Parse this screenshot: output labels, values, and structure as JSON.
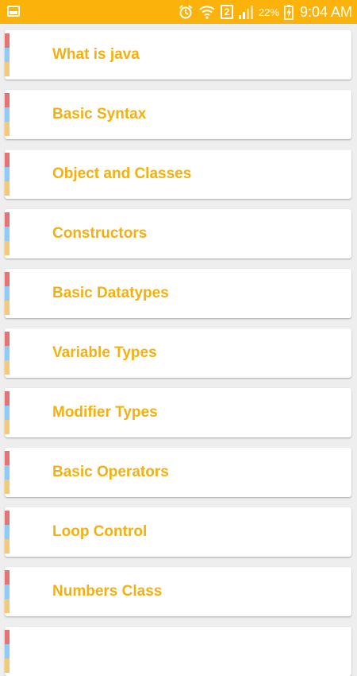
{
  "status_bar": {
    "battery_percent": "22%",
    "time": "9:04 AM",
    "sim_slot": "2",
    "color": "#fbb30b"
  },
  "topics": [
    {
      "label": "What is java"
    },
    {
      "label": "Basic Syntax"
    },
    {
      "label": "Object and Classes"
    },
    {
      "label": "Constructors"
    },
    {
      "label": "Basic Datatypes"
    },
    {
      "label": "Variable Types"
    },
    {
      "label": "Modifier Types"
    },
    {
      "label": "Basic Operators"
    },
    {
      "label": "Loop Control"
    },
    {
      "label": "Numbers Class"
    }
  ],
  "colors": {
    "accent_text": "#f4b00e",
    "stripe_top": "#e57373",
    "stripe_middle": "#90caf9",
    "stripe_bottom": "#f5c97a"
  }
}
